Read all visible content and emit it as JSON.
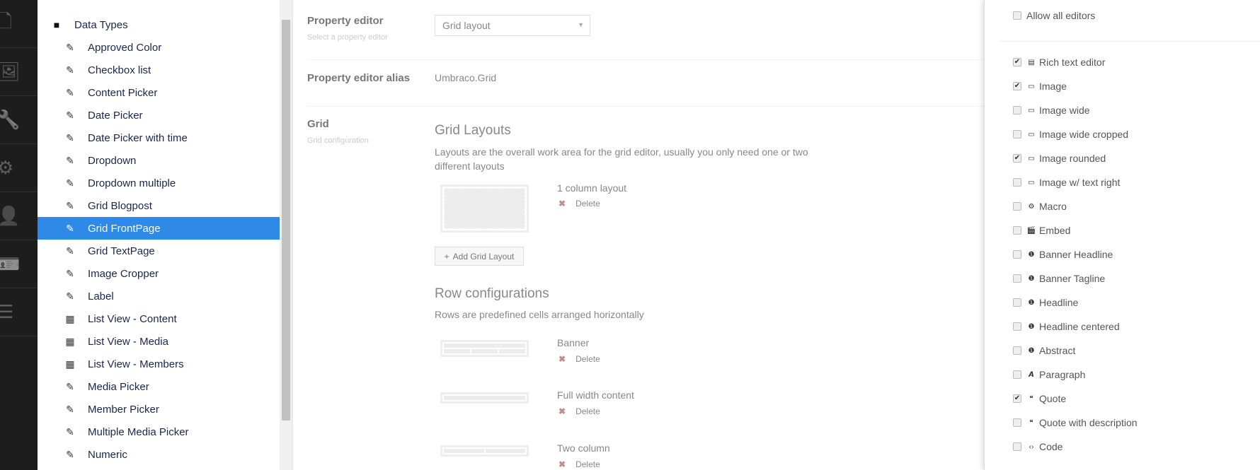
{
  "appbar": [
    {
      "icon": "document-icon",
      "glyph": "🗋"
    },
    {
      "icon": "image-icon",
      "glyph": "🖼"
    },
    {
      "icon": "wrench-icon",
      "glyph": "🔧"
    },
    {
      "icon": "gear-icon",
      "glyph": "⚙"
    },
    {
      "icon": "user-icon",
      "glyph": "👤"
    },
    {
      "icon": "member-card-icon",
      "glyph": "🪪"
    },
    {
      "icon": "forms-icon",
      "glyph": "☰"
    }
  ],
  "tree": {
    "root": "Data Types",
    "items": [
      {
        "label": "Approved Color",
        "icon": "datatype-icon"
      },
      {
        "label": "Checkbox list",
        "icon": "datatype-icon"
      },
      {
        "label": "Content Picker",
        "icon": "datatype-icon"
      },
      {
        "label": "Date Picker",
        "icon": "datatype-icon"
      },
      {
        "label": "Date Picker with time",
        "icon": "datatype-icon"
      },
      {
        "label": "Dropdown",
        "icon": "datatype-icon"
      },
      {
        "label": "Dropdown multiple",
        "icon": "datatype-icon"
      },
      {
        "label": "Grid Blogpost",
        "icon": "datatype-icon"
      },
      {
        "label": "Grid FrontPage",
        "icon": "datatype-icon",
        "selected": true
      },
      {
        "label": "Grid TextPage",
        "icon": "datatype-icon"
      },
      {
        "label": "Image Cropper",
        "icon": "datatype-icon"
      },
      {
        "label": "Label",
        "icon": "datatype-icon"
      },
      {
        "label": "List View - Content",
        "icon": "list-view-icon"
      },
      {
        "label": "List View - Media",
        "icon": "list-view-icon"
      },
      {
        "label": "List View - Members",
        "icon": "list-view-icon"
      },
      {
        "label": "Media Picker",
        "icon": "datatype-icon"
      },
      {
        "label": "Member Picker",
        "icon": "datatype-icon"
      },
      {
        "label": "Multiple Media Picker",
        "icon": "datatype-icon"
      },
      {
        "label": "Numeric",
        "icon": "datatype-icon"
      }
    ]
  },
  "main": {
    "property_editor": {
      "label": "Property editor",
      "description": "Select a property editor",
      "value": "Grid layout"
    },
    "alias": {
      "label": "Property editor alias",
      "value": "Umbraco.Grid"
    },
    "grid": {
      "label": "Grid",
      "description": "Grid configuration"
    },
    "layouts": {
      "title": "Grid Layouts",
      "description_line1": "Layouts are the overall work area for the grid editor, usually you only need one or two",
      "description_line2": "different layouts",
      "items": [
        {
          "name": "1 column layout",
          "delete": "Delete"
        }
      ],
      "add_label": "Add Grid Layout"
    },
    "rows": {
      "title": "Row configurations",
      "description": "Rows are predefined cells arranged horizontally",
      "items": [
        {
          "name": "Banner",
          "delete": "Delete"
        },
        {
          "name": "Full width content",
          "delete": "Delete"
        },
        {
          "name": "Two column",
          "delete": "Delete"
        }
      ]
    }
  },
  "editors": {
    "allow_all": {
      "label": "Allow all editors",
      "checked": false
    },
    "items": [
      {
        "label": "Rich text editor",
        "icon": "rte-icon",
        "checked": true
      },
      {
        "label": "Image",
        "icon": "picture-icon",
        "checked": true
      },
      {
        "label": "Image wide",
        "icon": "picture-icon",
        "checked": false
      },
      {
        "label": "Image wide cropped",
        "icon": "picture-icon",
        "checked": false
      },
      {
        "label": "Image rounded",
        "icon": "picture-icon",
        "checked": true
      },
      {
        "label": "Image w/ text right",
        "icon": "picture-icon",
        "checked": false
      },
      {
        "label": "Macro",
        "icon": "settings-alt-icon",
        "checked": false
      },
      {
        "label": "Embed",
        "icon": "movie-icon",
        "checked": false
      },
      {
        "label": "Banner Headline",
        "icon": "coin-icon",
        "checked": false
      },
      {
        "label": "Banner Tagline",
        "icon": "coin-icon",
        "checked": false
      },
      {
        "label": "Headline",
        "icon": "coin-icon",
        "checked": false
      },
      {
        "label": "Headline centered",
        "icon": "coin-icon",
        "checked": false
      },
      {
        "label": "Abstract",
        "icon": "coin-icon",
        "checked": false
      },
      {
        "label": "Paragraph",
        "icon": "font-icon",
        "checked": false
      },
      {
        "label": "Quote",
        "icon": "quote-icon",
        "checked": true
      },
      {
        "label": "Quote with description",
        "icon": "quote-icon",
        "checked": false
      },
      {
        "label": "Code",
        "icon": "code-icon",
        "checked": false
      }
    ]
  },
  "colors": {
    "selected": "#2e8ae6",
    "appbar": "#1d1d1d"
  }
}
